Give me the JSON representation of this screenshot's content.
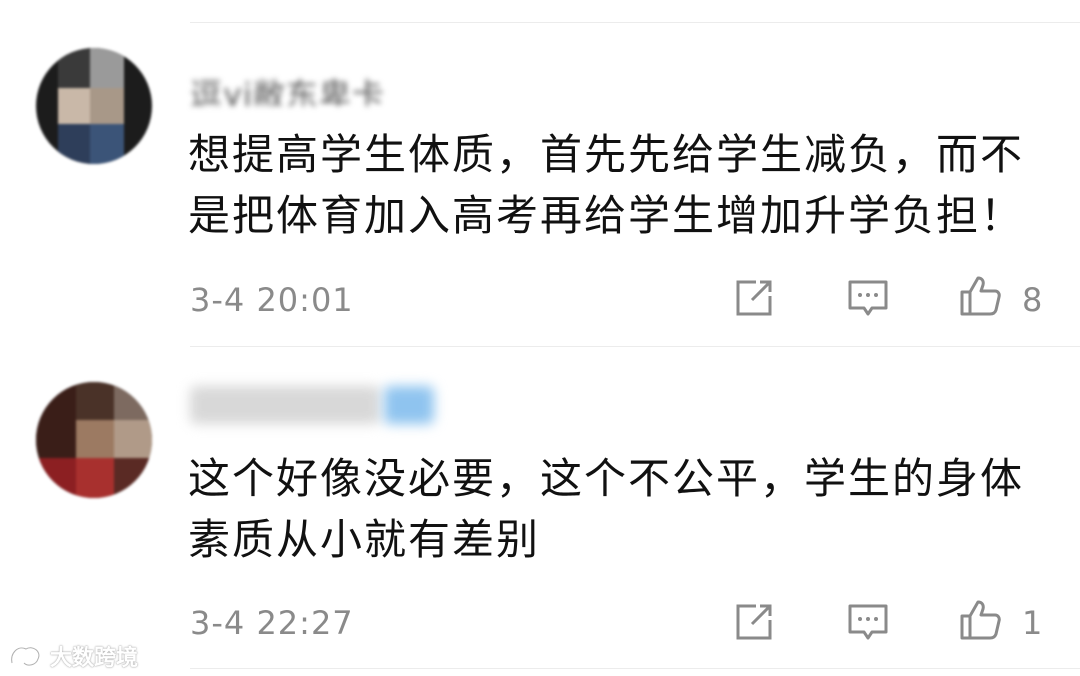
{
  "comments": [
    {
      "username": "逗yi敝东卑卡",
      "text": "想提高学生体质，首先先给学生减负，而不是把体育加入高考再给学生增加升学负担！",
      "timestamp": "3-4 20:01",
      "likes": "8"
    },
    {
      "username": "",
      "text": "这个好像没必要，这个不公平，学生的身体素质从小就有差别",
      "timestamp": "3-4 22:27",
      "likes": "1"
    }
  ],
  "icons": {
    "share": "share-icon",
    "comment": "comment-icon",
    "like": "thumbs-up-icon"
  },
  "watermark": {
    "text": "大数跨境"
  },
  "colors": {
    "text": "#111111",
    "meta": "#8a8a8a",
    "divider": "#ececec",
    "background": "#ffffff"
  }
}
